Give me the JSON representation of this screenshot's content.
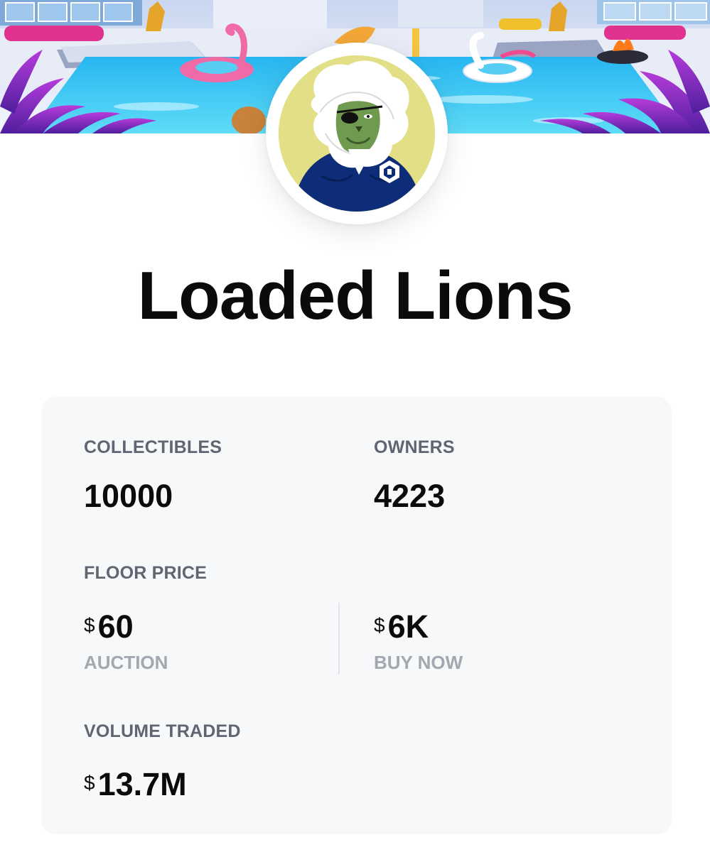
{
  "collection": {
    "name": "Loaded Lions"
  },
  "stats": {
    "collectibles": {
      "label": "COLLECTIBLES",
      "value": "10000"
    },
    "owners": {
      "label": "OWNERS",
      "value": "4223"
    },
    "floor_price": {
      "label": "FLOOR PRICE",
      "auction": {
        "currency": "$",
        "value": "60",
        "label": "AUCTION"
      },
      "buy_now": {
        "currency": "$",
        "value": "6K",
        "label": "BUY NOW"
      }
    },
    "volume_traded": {
      "label": "VOLUME TRADED",
      "currency": "$",
      "value": "13.7M"
    }
  },
  "colors": {
    "card_background": "#f7f8fa",
    "label": "#5f6672",
    "sub_label": "#a2a7b0",
    "value": "#0b0b0b",
    "avatar_background": "#e3df86",
    "shirt": "#0e2d78"
  },
  "icons": {
    "banner": "pool-party-banner-image",
    "avatar": "lion-avatar-image",
    "shirt_logo": "crypto-com-logo-icon"
  }
}
